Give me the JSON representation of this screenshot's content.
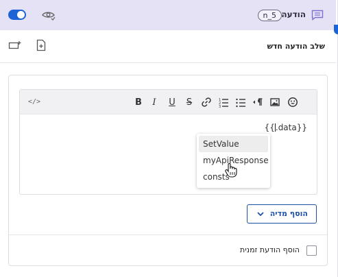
{
  "header": {
    "title": "הודעה",
    "node_id": "n_5",
    "toggle_on": true,
    "accent_color": "#1c63d6",
    "bar_color": "#e6e2f6"
  },
  "step": {
    "title": "שלב הודעה חדש"
  },
  "editor": {
    "toolbar": [
      "code-view",
      "bold",
      "italic",
      "underline",
      "strikethrough",
      "link",
      "ordered-list",
      "bullet-list",
      "paragraph-direction",
      "image",
      "emoji"
    ],
    "labels": {
      "bold": "B",
      "italic": "I",
      "underline": "U",
      "strike": "S"
    },
    "content_prefix": "{{",
    "content_suffix": ".data}}"
  },
  "autocomplete": {
    "items": [
      {
        "label": "SetValue",
        "active": true
      },
      {
        "label": "myApiResponse",
        "active": false
      },
      {
        "label": "consts",
        "active": false
      }
    ]
  },
  "add_media": {
    "label": "הוסף מדיה"
  },
  "temp_message": {
    "label": "הוסף הודעת זמנית",
    "checked": false
  }
}
